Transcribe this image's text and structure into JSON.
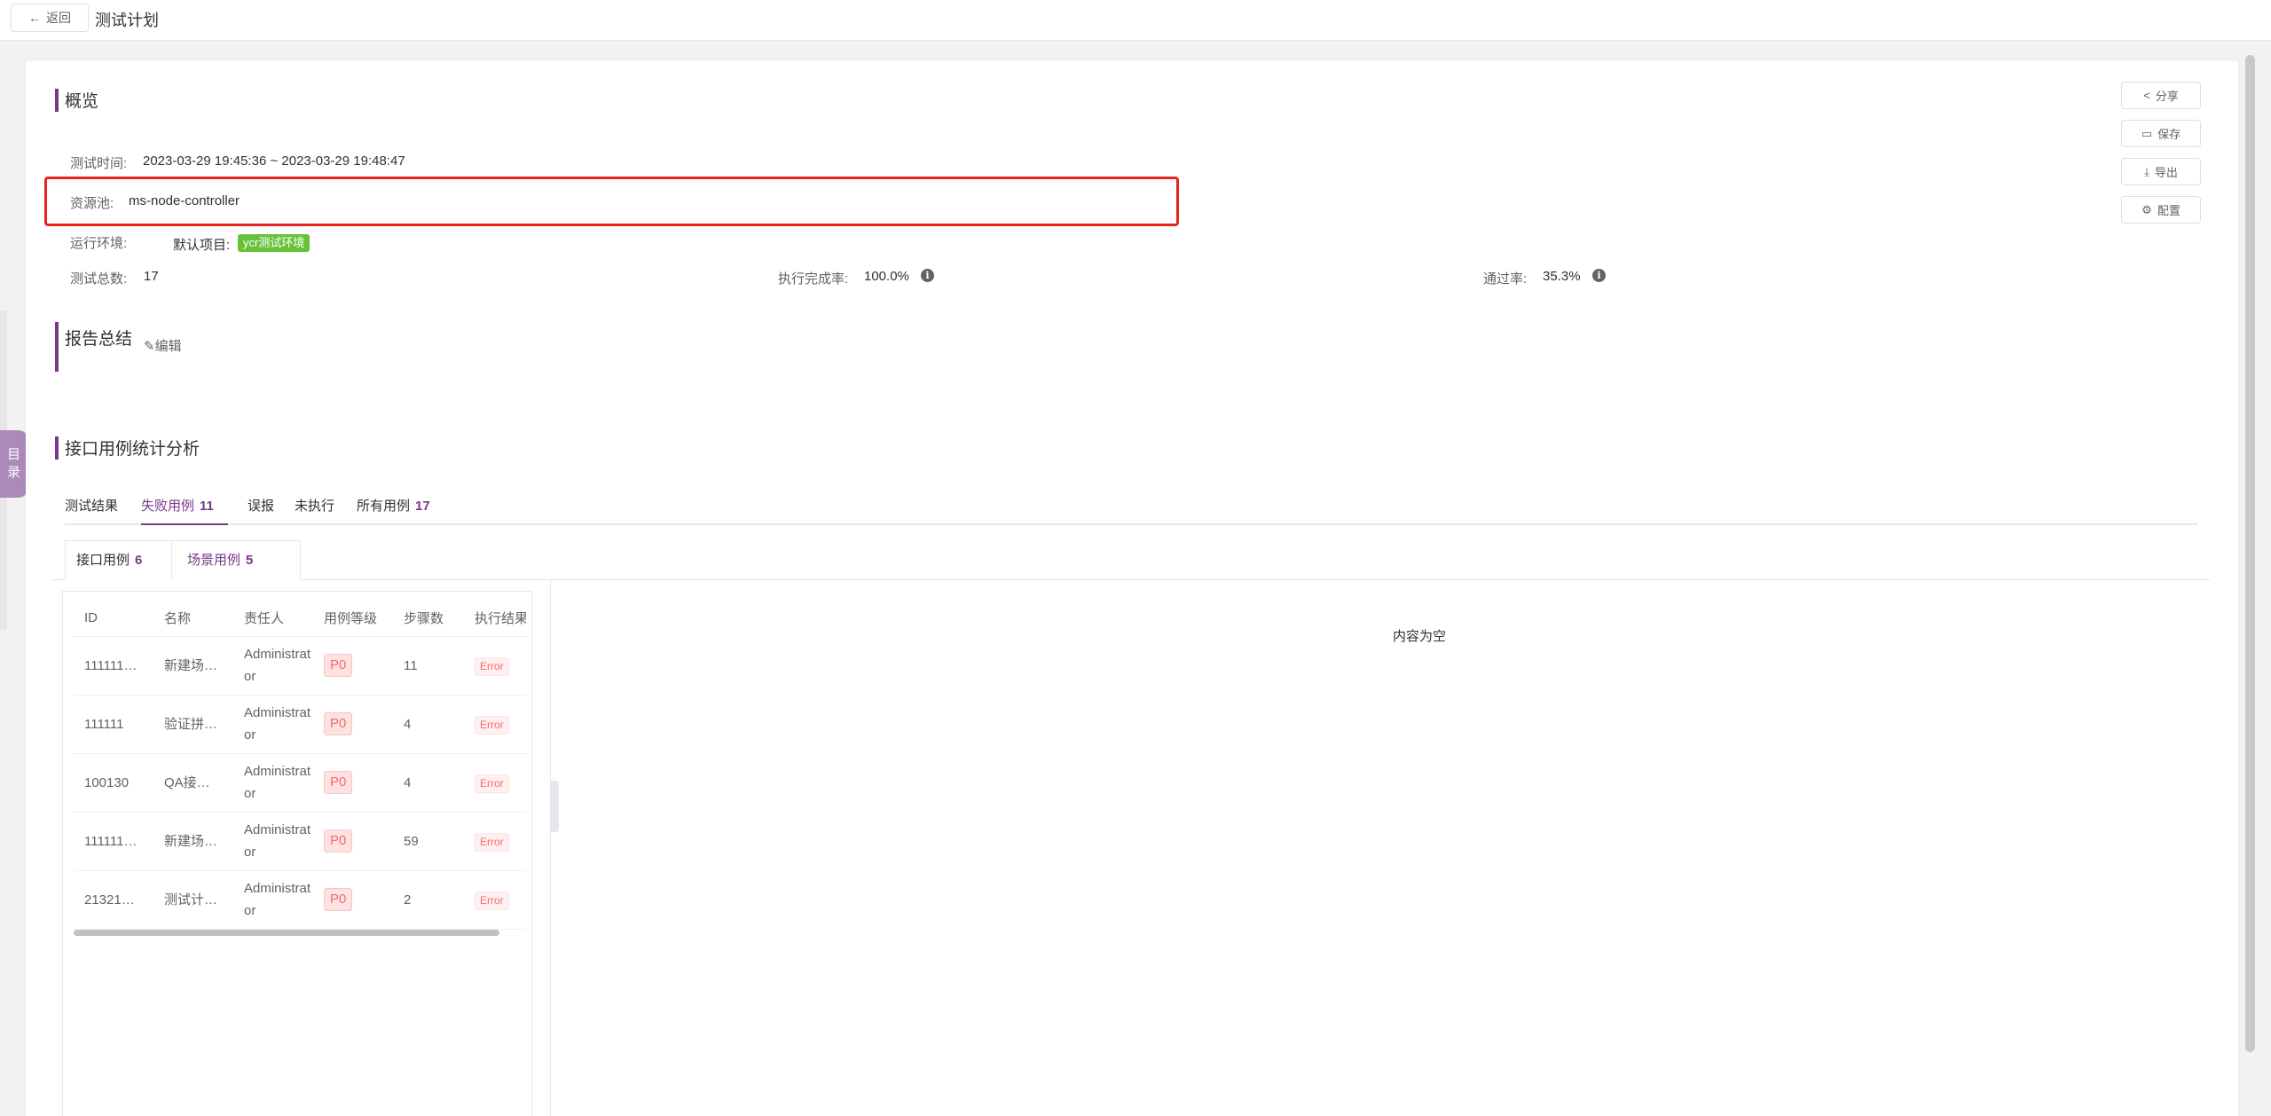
{
  "header": {
    "back_label": "返回",
    "title": "测试计划"
  },
  "toc": {
    "label_line1": "目",
    "label_line2": "录"
  },
  "overview": {
    "title": "概览",
    "test_time_label": "测试时间:",
    "test_time_value": "2023-03-29 19:45:36 ~ 2023-03-29 19:48:47",
    "resource_pool_label": "资源池:",
    "resource_pool_value": "ms-node-controller",
    "env_label": "运行环境:",
    "project_label": "默认项目:",
    "env_tag": "ycr测试环境",
    "env_tag_color": "#67c23a",
    "total_label": "测试总数:",
    "total_value": "17",
    "completion_label": "执行完成率:",
    "completion_value": "100.0%",
    "pass_label": "通过率:",
    "pass_value": "35.3%"
  },
  "actions": {
    "share": "分享",
    "save": "保存",
    "export": "导出",
    "config": "配置"
  },
  "summary": {
    "title": "报告总结",
    "edit_label": "编辑"
  },
  "api_analysis": {
    "title": "接口用例统计分析",
    "tabs": [
      {
        "label": "测试结果",
        "count": ""
      },
      {
        "label": "失败用例",
        "count": "11"
      },
      {
        "label": "误报",
        "count": ""
      },
      {
        "label": "未执行",
        "count": ""
      },
      {
        "label": "所有用例",
        "count": "17"
      }
    ],
    "subtabs": [
      {
        "label": "接口用例",
        "count": "6"
      },
      {
        "label": "场景用例",
        "count": "5"
      }
    ],
    "empty_text": "内容为空"
  },
  "table": {
    "columns": [
      "ID",
      "名称",
      "责任人",
      "用例等级",
      "步骤数",
      "执行结果"
    ],
    "rows": [
      {
        "id": "111111…",
        "name": "新建场…",
        "owner": "Administrator",
        "level": "P0",
        "steps": "11",
        "result": "Error"
      },
      {
        "id": "111111",
        "name": "验证拼…",
        "owner": "Administrator",
        "level": "P0",
        "steps": "4",
        "result": "Error"
      },
      {
        "id": "100130",
        "name": "QA接…",
        "owner": "Administrator",
        "level": "P0",
        "steps": "4",
        "result": "Error"
      },
      {
        "id": "111111…",
        "name": "新建场…",
        "owner": "Administrator",
        "level": "P0",
        "steps": "59",
        "result": "Error"
      },
      {
        "id": "21321…",
        "name": "测试计…",
        "owner": "Administrator",
        "level": "P0",
        "steps": "2",
        "result": "Error"
      }
    ]
  },
  "colors": {
    "accent": "#783887",
    "highlight": "#e8241c",
    "error": "#f56c6c"
  }
}
